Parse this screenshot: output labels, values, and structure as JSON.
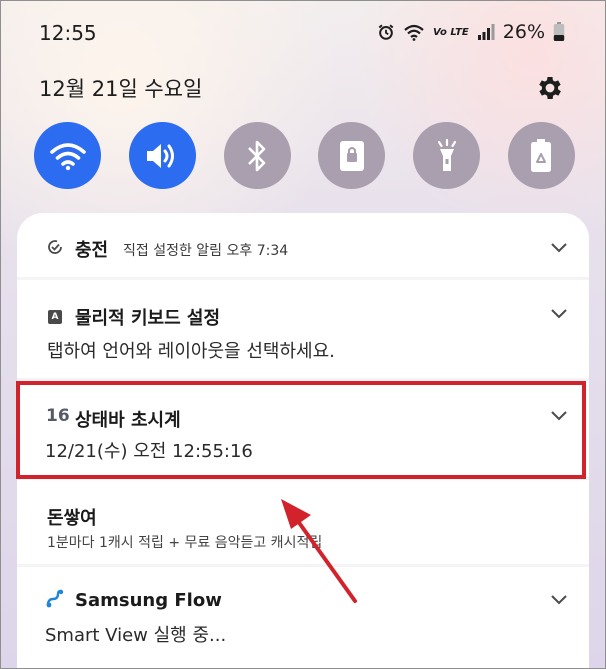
{
  "status_bar": {
    "time": "12:55",
    "lte_label": "Vo LTE",
    "battery": "26%"
  },
  "header": {
    "date": "12월 21일 수요일"
  },
  "quick_settings": [
    {
      "name": "wifi",
      "icon": "wifi-icon",
      "state": "on"
    },
    {
      "name": "sound",
      "icon": "volume-icon",
      "state": "on"
    },
    {
      "name": "bluetooth",
      "icon": "bluetooth-icon",
      "state": "off"
    },
    {
      "name": "lock",
      "icon": "lock-icon",
      "state": "off"
    },
    {
      "name": "flashlight",
      "icon": "flashlight-icon",
      "state": "off"
    },
    {
      "name": "power_saving",
      "icon": "battery-recycle-icon",
      "state": "off"
    }
  ],
  "notifications": [
    {
      "app": "충전",
      "meta": "직접 설정한 알림 오후 7:34"
    },
    {
      "app": "물리적 키보드 설정",
      "body": "탭하여 언어와 레이아웃을 선택하세요."
    },
    {
      "app_icon_text": "16",
      "app": "상태바 초시계",
      "body": "12/21(수) 오전 12:55:16"
    },
    {
      "app": "돈쌓여",
      "body": "1분마다 1캐시 적립 + 무료 음악듣고 캐시적립"
    },
    {
      "app": "Samsung Flow",
      "body": "Smart View 실행 중..."
    }
  ],
  "colors": {
    "accent": "#2c6cf0",
    "inactive_tile": "#aa9fae",
    "highlight": "#d2222b"
  }
}
